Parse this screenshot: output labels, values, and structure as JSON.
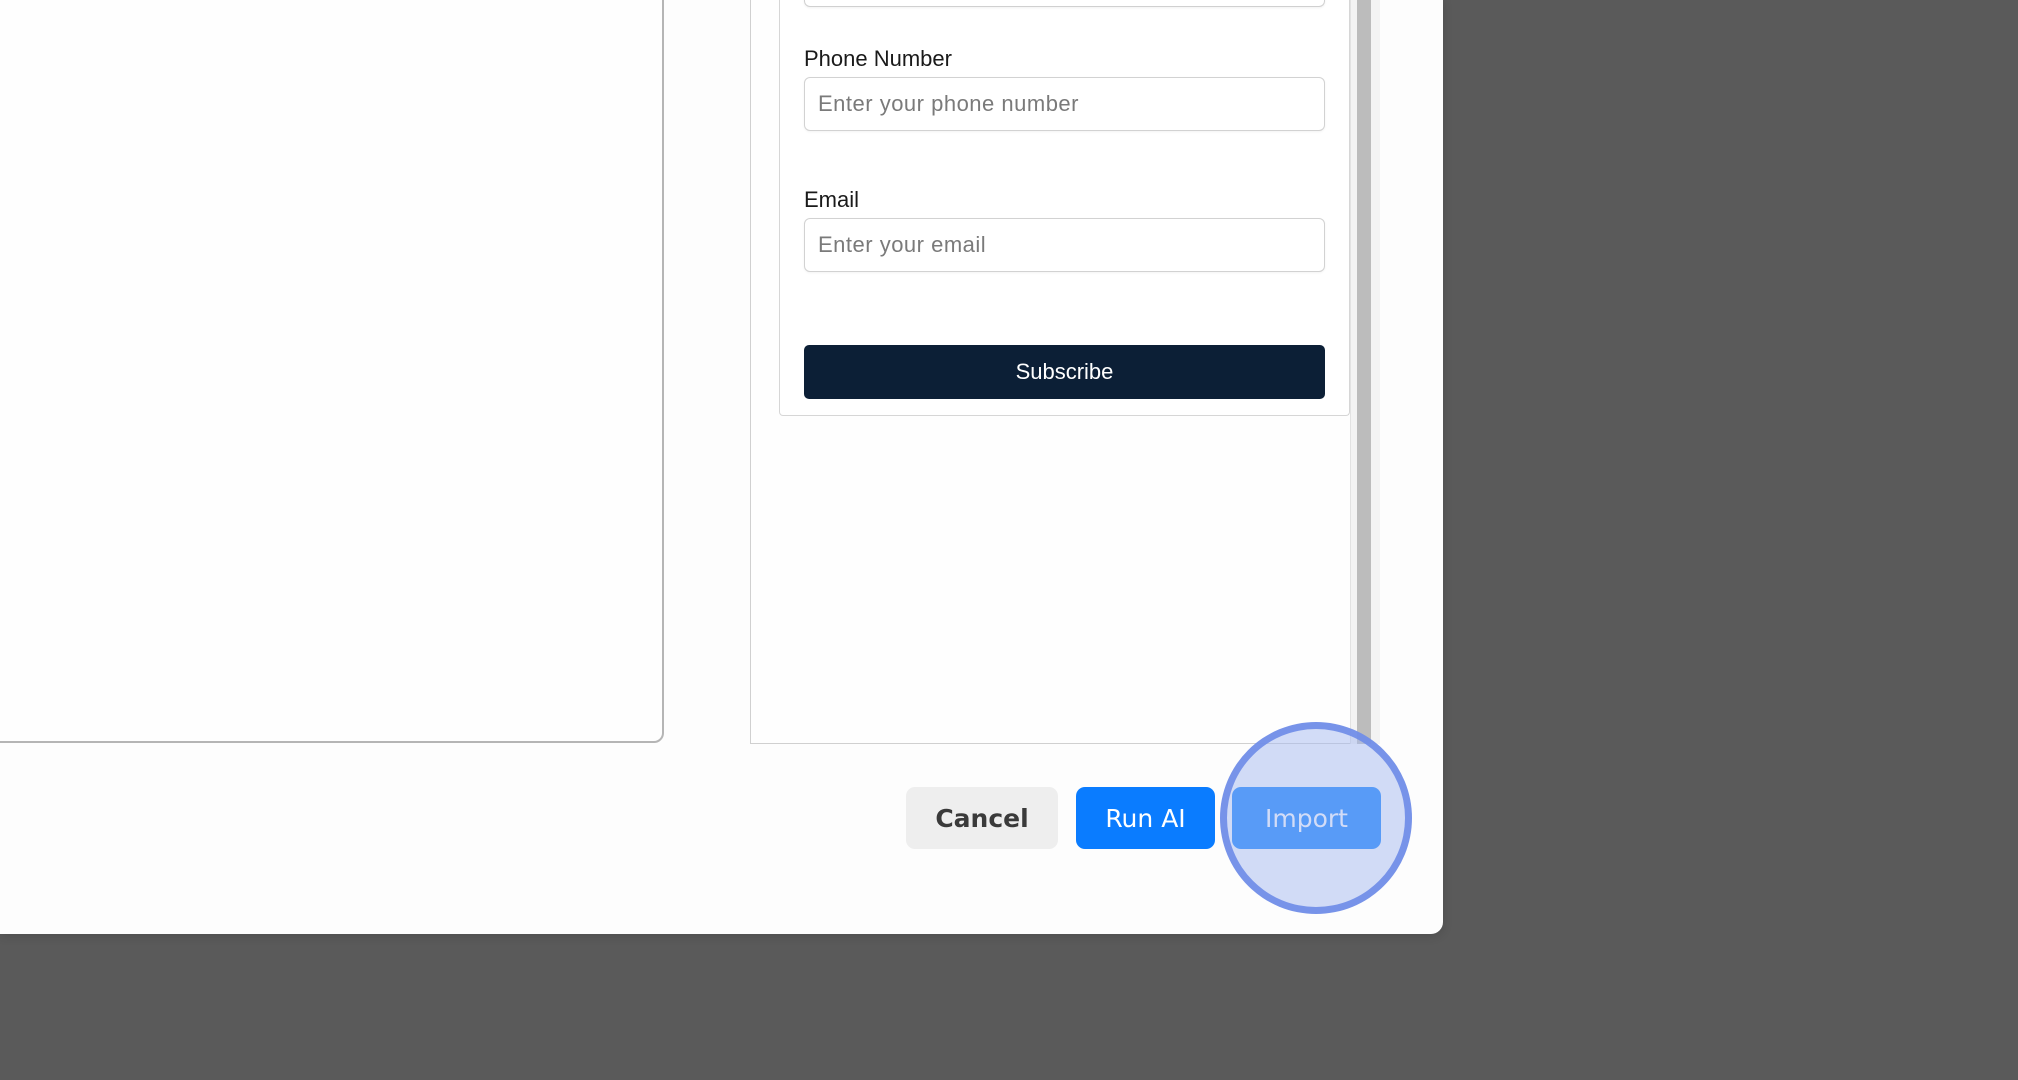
{
  "form": {
    "phone_label": "Phone Number",
    "phone_placeholder": "Enter your phone number",
    "email_label": "Email",
    "email_placeholder": "Enter your email",
    "subscribe_label": "Subscribe"
  },
  "footer": {
    "cancel_label": "Cancel",
    "run_ai_label": "Run AI",
    "import_label": "Import"
  },
  "colors": {
    "backdrop": "#5a5a5a",
    "primary_button": "#0a7cff",
    "subscribe_button": "#0c1f36",
    "click_highlight": "#6e8ce8"
  }
}
